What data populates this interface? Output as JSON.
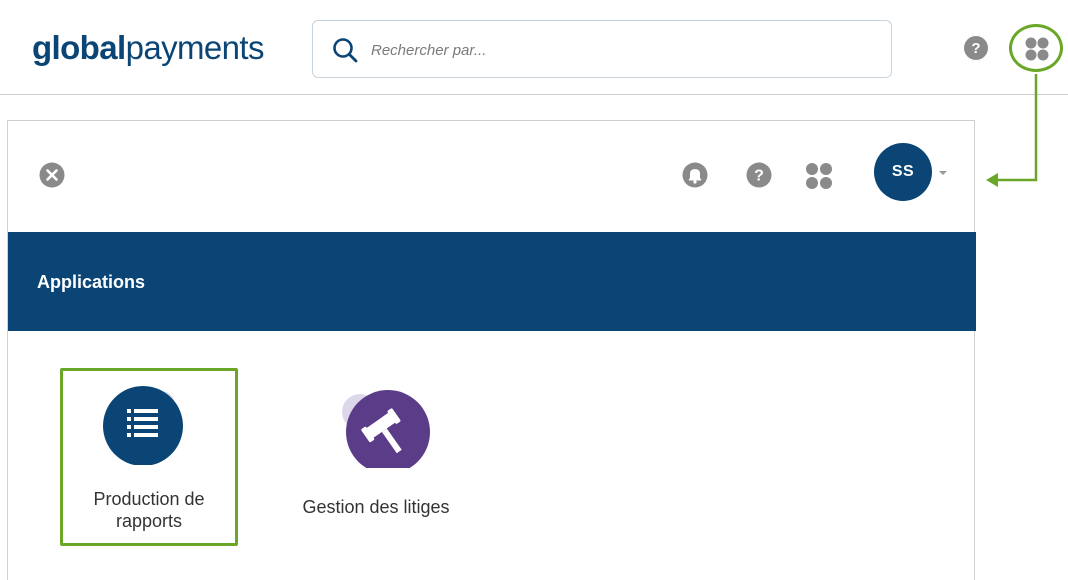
{
  "header": {
    "logo": {
      "bold": "global",
      "regular": "payments"
    },
    "search": {
      "placeholder": "Rechercher par..."
    },
    "help_icon": "question-circle-icon",
    "apps_icon": "apps-grid-icon"
  },
  "panel": {
    "icons": [
      "close-circle-icon",
      "bell-icon",
      "question-circle-icon",
      "apps-grid-icon"
    ],
    "avatar_initials": "SS",
    "banner_title": "Applications",
    "apps": [
      {
        "label_line1": "Production de",
        "label_line2": "rapports",
        "icon": "list-icon",
        "color": "#0a4575",
        "highlighted": true
      },
      {
        "label_line1": "Gestion des litiges",
        "icon": "gavel-icon",
        "color": "#5b3c88",
        "highlighted": false
      }
    ]
  },
  "colors": {
    "brand": "#0a4575",
    "highlight": "#6aa628",
    "icon_gray": "#8a8a8a",
    "purple": "#5b3c88"
  }
}
